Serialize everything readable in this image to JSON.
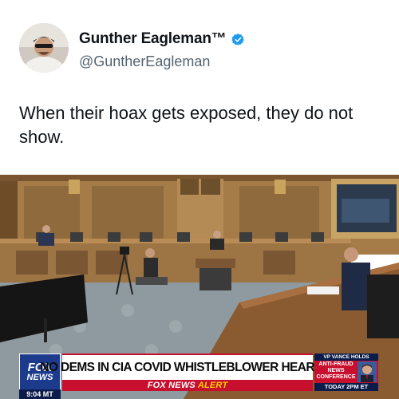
{
  "tweet": {
    "author": {
      "display_name": "Gunther Eagleman™",
      "handle": "@GuntherEagleman",
      "verified": true,
      "verified_color": "#1d9bf0"
    },
    "text": "When their hoax gets exposed, they do not show."
  },
  "media": {
    "chyron": {
      "network_logo_top": "FOX",
      "network_logo_bottom": "NEWS",
      "time": "9:04 MT",
      "headline": "NO DEMS IN CIA COVID WHISTLEBLOWER HEARING",
      "alert_prefix": "FOX NEWS",
      "alert_suffix": "ALERT",
      "promo_top": "VP VANCE HOLDS",
      "promo_main": "ANTI-FRAUD NEWS CONFERENCE",
      "promo_bottom": "TODAY 2PM ET",
      "colors": {
        "red": "#c8102e",
        "navy": "#0b1c4a",
        "accent_yellow": "#ffd200"
      }
    }
  }
}
